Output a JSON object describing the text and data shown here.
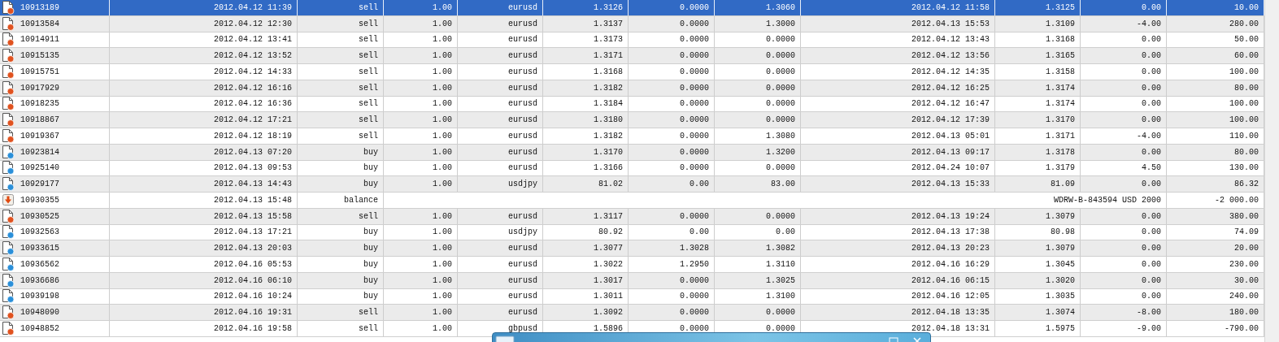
{
  "rows": [
    {
      "kind": "sell",
      "selected": true,
      "ticket": "10913189",
      "open_time": "2012.04.12 11:39",
      "type": "sell",
      "size": "1.00",
      "symbol": "eurusd",
      "price": "1.3126",
      "sl": "0.0000",
      "tp": "1.3060",
      "close_time": "2012.04.12 11:58",
      "close_price": "1.3125",
      "swap": "0.00",
      "profit": "10.00"
    },
    {
      "kind": "sell",
      "selected": false,
      "ticket": "10913584",
      "open_time": "2012.04.12 12:30",
      "type": "sell",
      "size": "1.00",
      "symbol": "eurusd",
      "price": "1.3137",
      "sl": "0.0000",
      "tp": "1.3000",
      "close_time": "2012.04.13 15:53",
      "close_price": "1.3109",
      "swap": "-4.00",
      "profit": "280.00"
    },
    {
      "kind": "sell",
      "selected": false,
      "ticket": "10914911",
      "open_time": "2012.04.12 13:41",
      "type": "sell",
      "size": "1.00",
      "symbol": "eurusd",
      "price": "1.3173",
      "sl": "0.0000",
      "tp": "0.0000",
      "close_time": "2012.04.12 13:43",
      "close_price": "1.3168",
      "swap": "0.00",
      "profit": "50.00"
    },
    {
      "kind": "sell",
      "selected": false,
      "ticket": "10915135",
      "open_time": "2012.04.12 13:52",
      "type": "sell",
      "size": "1.00",
      "symbol": "eurusd",
      "price": "1.3171",
      "sl": "0.0000",
      "tp": "0.0000",
      "close_time": "2012.04.12 13:56",
      "close_price": "1.3165",
      "swap": "0.00",
      "profit": "60.00"
    },
    {
      "kind": "sell",
      "selected": false,
      "ticket": "10915751",
      "open_time": "2012.04.12 14:33",
      "type": "sell",
      "size": "1.00",
      "symbol": "eurusd",
      "price": "1.3168",
      "sl": "0.0000",
      "tp": "0.0000",
      "close_time": "2012.04.12 14:35",
      "close_price": "1.3158",
      "swap": "0.00",
      "profit": "100.00"
    },
    {
      "kind": "sell",
      "selected": false,
      "ticket": "10917929",
      "open_time": "2012.04.12 16:16",
      "type": "sell",
      "size": "1.00",
      "symbol": "eurusd",
      "price": "1.3182",
      "sl": "0.0000",
      "tp": "0.0000",
      "close_time": "2012.04.12 16:25",
      "close_price": "1.3174",
      "swap": "0.00",
      "profit": "80.00"
    },
    {
      "kind": "sell",
      "selected": false,
      "ticket": "10918235",
      "open_time": "2012.04.12 16:36",
      "type": "sell",
      "size": "1.00",
      "symbol": "eurusd",
      "price": "1.3184",
      "sl": "0.0000",
      "tp": "0.0000",
      "close_time": "2012.04.12 16:47",
      "close_price": "1.3174",
      "swap": "0.00",
      "profit": "100.00"
    },
    {
      "kind": "sell",
      "selected": false,
      "ticket": "10918867",
      "open_time": "2012.04.12 17:21",
      "type": "sell",
      "size": "1.00",
      "symbol": "eurusd",
      "price": "1.3180",
      "sl": "0.0000",
      "tp": "0.0000",
      "close_time": "2012.04.12 17:39",
      "close_price": "1.3170",
      "swap": "0.00",
      "profit": "100.00"
    },
    {
      "kind": "sell",
      "selected": false,
      "ticket": "10919367",
      "open_time": "2012.04.12 18:19",
      "type": "sell",
      "size": "1.00",
      "symbol": "eurusd",
      "price": "1.3182",
      "sl": "0.0000",
      "tp": "1.3080",
      "close_time": "2012.04.13 05:01",
      "close_price": "1.3171",
      "swap": "-4.00",
      "profit": "110.00"
    },
    {
      "kind": "buy",
      "selected": false,
      "ticket": "10923814",
      "open_time": "2012.04.13 07:20",
      "type": "buy",
      "size": "1.00",
      "symbol": "eurusd",
      "price": "1.3170",
      "sl": "0.0000",
      "tp": "1.3200",
      "close_time": "2012.04.13 09:17",
      "close_price": "1.3178",
      "swap": "0.00",
      "profit": "80.00"
    },
    {
      "kind": "buy",
      "selected": false,
      "ticket": "10925140",
      "open_time": "2012.04.13 09:53",
      "type": "buy",
      "size": "1.00",
      "symbol": "eurusd",
      "price": "1.3166",
      "sl": "0.0000",
      "tp": "0.0000",
      "close_time": "2012.04.24 10:07",
      "close_price": "1.3179",
      "swap": "4.50",
      "profit": "130.00"
    },
    {
      "kind": "buy",
      "selected": false,
      "ticket": "10929177",
      "open_time": "2012.04.13 14:43",
      "type": "buy",
      "size": "1.00",
      "symbol": "usdjpy",
      "price": "81.02",
      "sl": "0.00",
      "tp": "83.00",
      "close_time": "2012.04.13 15:33",
      "close_price": "81.09",
      "swap": "0.00",
      "profit": "86.32"
    },
    {
      "kind": "balance",
      "selected": false,
      "ticket": "10930355",
      "open_time": "2012.04.13 15:48",
      "type": "balance",
      "comment": "WDRW-B-843594 USD 2000",
      "profit": "-2 000.00"
    },
    {
      "kind": "sell",
      "selected": false,
      "ticket": "10930525",
      "open_time": "2012.04.13 15:58",
      "type": "sell",
      "size": "1.00",
      "symbol": "eurusd",
      "price": "1.3117",
      "sl": "0.0000",
      "tp": "0.0000",
      "close_time": "2012.04.13 19:24",
      "close_price": "1.3079",
      "swap": "0.00",
      "profit": "380.00"
    },
    {
      "kind": "buy",
      "selected": false,
      "ticket": "10932563",
      "open_time": "2012.04.13 17:21",
      "type": "buy",
      "size": "1.00",
      "symbol": "usdjpy",
      "price": "80.92",
      "sl": "0.00",
      "tp": "0.00",
      "close_time": "2012.04.13 17:38",
      "close_price": "80.98",
      "swap": "0.00",
      "profit": "74.09"
    },
    {
      "kind": "buy",
      "selected": false,
      "ticket": "10933615",
      "open_time": "2012.04.13 20:03",
      "type": "buy",
      "size": "1.00",
      "symbol": "eurusd",
      "price": "1.3077",
      "sl": "1.3028",
      "tp": "1.3082",
      "close_time": "2012.04.13 20:23",
      "close_price": "1.3079",
      "swap": "0.00",
      "profit": "20.00"
    },
    {
      "kind": "buy",
      "selected": false,
      "ticket": "10936562",
      "open_time": "2012.04.16 05:53",
      "type": "buy",
      "size": "1.00",
      "symbol": "eurusd",
      "price": "1.3022",
      "sl": "1.2950",
      "tp": "1.3110",
      "close_time": "2012.04.16 16:29",
      "close_price": "1.3045",
      "swap": "0.00",
      "profit": "230.00"
    },
    {
      "kind": "buy",
      "selected": false,
      "ticket": "10936686",
      "open_time": "2012.04.16 06:10",
      "type": "buy",
      "size": "1.00",
      "symbol": "eurusd",
      "price": "1.3017",
      "sl": "0.0000",
      "tp": "1.3025",
      "close_time": "2012.04.16 06:15",
      "close_price": "1.3020",
      "swap": "0.00",
      "profit": "30.00"
    },
    {
      "kind": "buy",
      "selected": false,
      "ticket": "10939198",
      "open_time": "2012.04.16 10:24",
      "type": "buy",
      "size": "1.00",
      "symbol": "eurusd",
      "price": "1.3011",
      "sl": "0.0000",
      "tp": "1.3100",
      "close_time": "2012.04.16 12:05",
      "close_price": "1.3035",
      "swap": "0.00",
      "profit": "240.00"
    },
    {
      "kind": "sell",
      "selected": false,
      "ticket": "10948090",
      "open_time": "2012.04.16 19:31",
      "type": "sell",
      "size": "1.00",
      "symbol": "eurusd",
      "price": "1.3092",
      "sl": "0.0000",
      "tp": "0.0000",
      "close_time": "2012.04.18 13:35",
      "close_price": "1.3074",
      "swap": "-8.00",
      "profit": "180.00"
    },
    {
      "kind": "sell",
      "selected": false,
      "ticket": "10948852",
      "open_time": "2012.04.16 19:58",
      "type": "sell",
      "size": "1.00",
      "symbol": "gbpusd",
      "price": "1.5896",
      "sl": "0.0000",
      "tp": "0.0000",
      "close_time": "2012.04.18 13:31",
      "close_price": "1.5975",
      "swap": "-9.00",
      "profit": "-790.00"
    }
  ]
}
